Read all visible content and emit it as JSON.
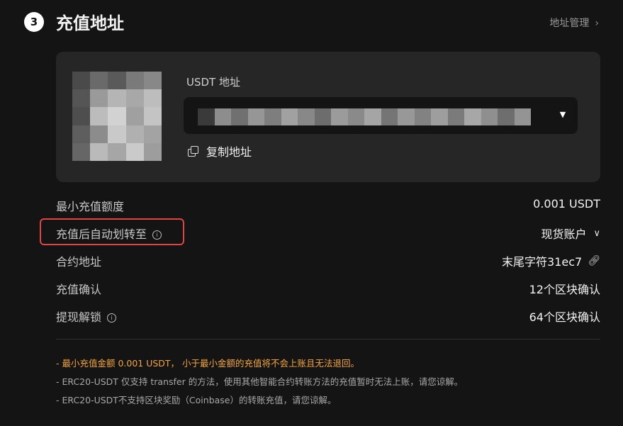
{
  "header": {
    "step_number": "3",
    "title": "充值地址",
    "address_manage_label": "地址管理"
  },
  "card": {
    "address_label": "USDT 地址",
    "copy_label": "复制地址"
  },
  "details": [
    {
      "label": "最小充值额度",
      "value": "0.001 USDT"
    },
    {
      "label": "充值后自动划转至",
      "value": "现货账户"
    },
    {
      "label": "合约地址",
      "value": "末尾字符31ec7"
    },
    {
      "label": "充值确认",
      "value": "12个区块确认"
    },
    {
      "label": "提现解锁",
      "value": "64个区块确认"
    }
  ],
  "notes": [
    "- 最小充值金额 0.001 USDT， 小于最小金额的充值将不会上账且无法退回。",
    "- ERC20-USDT 仅支持 transfer 的方法，使用其他智能合约转账方法的充值暂时无法上账，请您谅解。",
    "- ERC20-USDT不支持区块奖励（Coinbase）的转账充值，请您谅解。"
  ],
  "colors": {
    "background": "#141414",
    "card": "#262626",
    "warning": "#f3a53a",
    "highlight_border": "#e04545"
  },
  "icons": {
    "address_manage": "chevron-right-icon",
    "dropdown": "caret-down-icon",
    "copy": "copy-icon",
    "info": "info-icon",
    "account_select": "chevron-down-icon",
    "contract_link": "link-icon"
  }
}
